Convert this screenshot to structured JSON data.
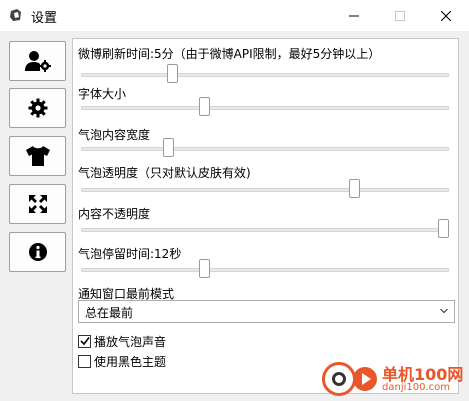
{
  "window": {
    "title": "设置"
  },
  "sidebar": {
    "items": [
      {
        "icon": "user-settings-icon"
      },
      {
        "icon": "gear-icon"
      },
      {
        "icon": "tshirt-icon"
      },
      {
        "icon": "expand-arrows-icon"
      },
      {
        "icon": "info-icon"
      }
    ]
  },
  "settings": {
    "refresh_interval": {
      "label": "微博刷新时间:5分（由于微博API限制，最好5分钟以上）",
      "value": 0.24
    },
    "font_size": {
      "label": "字体大小",
      "value": 0.33
    },
    "bubble_width": {
      "label": "气泡内容宽度",
      "value": 0.23
    },
    "bubble_transparency": {
      "label": "气泡透明度（只对默认皮肤有效)",
      "value": 0.75
    },
    "content_opacity": {
      "label": "内容不透明度",
      "value": 1.0
    },
    "bubble_duration": {
      "label": "气泡停留时间:12秒",
      "value": 0.33
    },
    "notify_mode": {
      "label": "通知窗口最前模式",
      "selected": "总在最前"
    },
    "play_sound": {
      "label": "播放气泡声音",
      "checked": true
    },
    "dark_theme": {
      "label": "使用黑色主题",
      "checked": false
    }
  },
  "watermark": {
    "text": "单机100网",
    "sub": "danji100.com"
  },
  "colors": {
    "accent": "#e8562a",
    "panel_bg": "#ffffff",
    "window_bg": "#f0f0f0"
  }
}
